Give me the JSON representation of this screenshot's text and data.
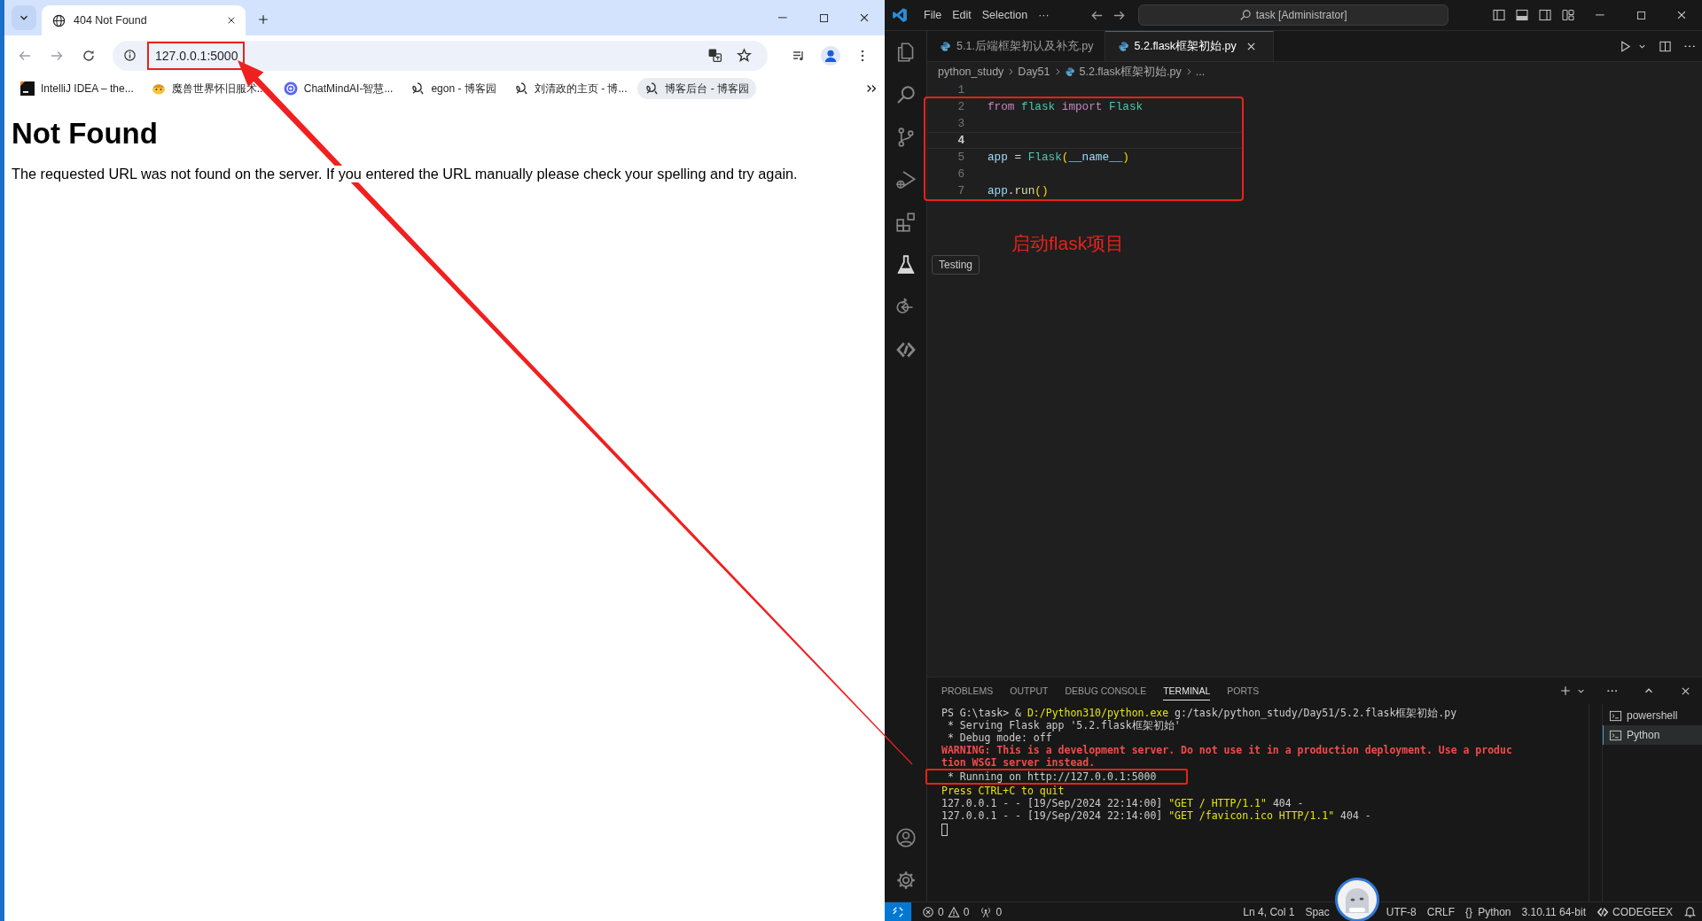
{
  "browser": {
    "tabs": [
      {
        "title": "404 Not Found",
        "selected": true
      }
    ],
    "address": {
      "url": "127.0.0.1:5000",
      "marked": true
    },
    "bookmarks": [
      {
        "kind": "app",
        "label": "IntelliJ IDEA – the...",
        "highlighted": false
      },
      {
        "kind": "emoji",
        "label": "魔兽世界怀旧服术...",
        "highlighted": false
      },
      {
        "kind": "ring",
        "label": "ChatMindAI-智慧...",
        "highlighted": false
      },
      {
        "kind": "site",
        "label": "egon - 博客园",
        "highlighted": false
      },
      {
        "kind": "site",
        "label": "刘清政的主页 - 博...",
        "highlighted": false
      },
      {
        "kind": "site",
        "label": "博客后台 - 博客园",
        "highlighted": true
      }
    ],
    "page": {
      "heading": "Not Found",
      "message": "The requested URL was not found on the server. If you entered the URL manually please check your spelling and try again."
    }
  },
  "vscode": {
    "menu": [
      "File",
      "Edit",
      "Selection",
      "···"
    ],
    "command_center": "task [Administrator]",
    "tabs": [
      {
        "label": "5.1.后端框架初认及补充.py",
        "selected": false
      },
      {
        "label": "5.2.flask框架初始.py",
        "selected": true
      }
    ],
    "breadcrumbs": [
      "python_study",
      "Day51",
      "5.2.flask框架初始.py",
      "..."
    ],
    "lines": [
      {
        "number": "1",
        "current": false,
        "marked": false
      },
      {
        "number": "2",
        "current": false,
        "marked": true,
        "tokens": [
          {
            "kind": "keyword",
            "text": "from "
          },
          {
            "kind": "type",
            "text": "flask "
          },
          {
            "kind": "keyword",
            "text": "import "
          },
          {
            "kind": "type",
            "text": "Flask"
          }
        ]
      },
      {
        "number": "3",
        "current": false,
        "marked": true
      },
      {
        "number": "4",
        "current": true,
        "marked": true
      },
      {
        "number": "5",
        "current": false,
        "marked": true,
        "tokens": [
          {
            "kind": "variable",
            "text": "app"
          },
          {
            "kind": "plain",
            "text": " = "
          },
          {
            "kind": "type",
            "text": "Flask"
          },
          {
            "kind": "bracket",
            "text": "("
          },
          {
            "kind": "variable",
            "text": "__name__"
          },
          {
            "kind": "bracket",
            "text": ")"
          }
        ]
      },
      {
        "number": "6",
        "current": false,
        "marked": true
      },
      {
        "number": "7",
        "current": false,
        "marked": true,
        "tokens": [
          {
            "kind": "variable",
            "text": "app"
          },
          {
            "kind": "plain",
            "text": "."
          },
          {
            "kind": "function",
            "text": "run"
          },
          {
            "kind": "bracket",
            "text": "()"
          }
        ]
      }
    ],
    "annotation": "启动flask项目",
    "tooltip": "Testing",
    "panel": {
      "tabs": [
        {
          "label": "PROBLEMS",
          "selected": false
        },
        {
          "label": "OUTPUT",
          "selected": false
        },
        {
          "label": "DEBUG CONSOLE",
          "selected": false
        },
        {
          "label": "TERMINAL",
          "selected": true
        },
        {
          "label": "PORTS",
          "selected": false
        }
      ],
      "terminal": [
        {
          "kind": "normal",
          "marked": false,
          "segments": [
            {
              "kind": "plain",
              "text": "PS G:\\task> & "
            },
            {
              "kind": "path",
              "text": "D:/Python310/python.exe"
            },
            {
              "kind": "plain",
              "text": " g:/task/python_study/Day51/5.2.flask框架初始.py"
            }
          ]
        },
        {
          "kind": "normal",
          "marked": false,
          "segments": [
            {
              "kind": "plain",
              "text": " * Serving Flask app '5.2.flask框架初始'"
            }
          ]
        },
        {
          "kind": "normal",
          "marked": false,
          "segments": [
            {
              "kind": "plain",
              "text": " * Debug mode: off"
            }
          ]
        },
        {
          "kind": "warning",
          "marked": false,
          "segments": [
            {
              "kind": "plain",
              "text": "WARNING: This is a development server. Do not use it in a production deployment. Use a produc"
            }
          ]
        },
        {
          "kind": "warning",
          "marked": false,
          "segments": [
            {
              "kind": "plain",
              "text": "tion WSGI server instead."
            }
          ]
        },
        {
          "kind": "normal",
          "marked": true,
          "segments": [
            {
              "kind": "plain",
              "text": " * Running on http://127.0.0.1:5000"
            }
          ]
        },
        {
          "kind": "notice",
          "marked": false,
          "segments": [
            {
              "kind": "plain",
              "text": "Press CTRL+C to quit"
            }
          ]
        },
        {
          "kind": "normal",
          "marked": false,
          "segments": [
            {
              "kind": "plain",
              "text": "127.0.0.1 - - [19/Sep/2024 22:14:00] "
            },
            {
              "kind": "path",
              "text": "\"GET / HTTP/1.1\""
            },
            {
              "kind": "plain",
              "text": " 404 -"
            }
          ]
        },
        {
          "kind": "normal",
          "marked": false,
          "segments": [
            {
              "kind": "plain",
              "text": "127.0.0.1 - - [19/Sep/2024 22:14:00] "
            },
            {
              "kind": "path",
              "text": "\"GET /favicon.ico HTTP/1.1\""
            },
            {
              "kind": "plain",
              "text": " 404 -"
            }
          ]
        }
      ],
      "cursor": true,
      "instances": [
        {
          "label": "powershell",
          "selected": false
        },
        {
          "label": "Python",
          "selected": true
        }
      ]
    },
    "status_bar": {
      "left": [
        {
          "kind": "problems",
          "errors": "0",
          "warnings": "0"
        },
        {
          "kind": "ports",
          "text": "0"
        }
      ],
      "right": [
        {
          "kind": "text",
          "text": "Ln 4, Col 1"
        },
        {
          "kind": "covered",
          "text": "Spac"
        },
        {
          "kind": "text",
          "text": "UTF-8"
        },
        {
          "kind": "text",
          "text": "CRLF"
        },
        {
          "kind": "language",
          "icon": "{}",
          "text": "Python"
        },
        {
          "kind": "text",
          "text": "3.10.11 64-bit"
        },
        {
          "kind": "brand",
          "text": "CODEGEEX"
        },
        {
          "kind": "bell"
        }
      ]
    }
  }
}
